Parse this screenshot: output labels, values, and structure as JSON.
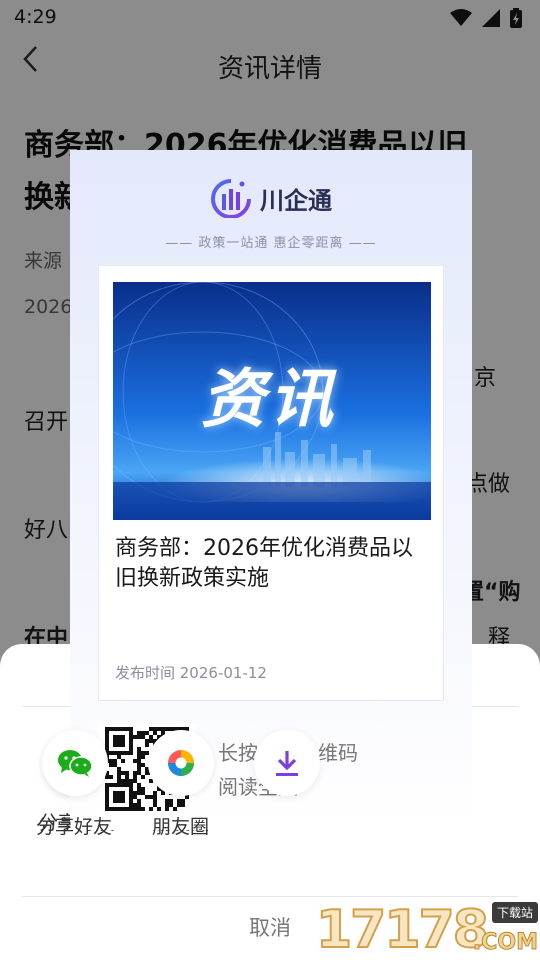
{
  "status_bar": {
    "time": "4:29"
  },
  "nav": {
    "title": "资讯详情"
  },
  "article": {
    "title_line1": "商务部：2026年优化消费品以旧",
    "title_line2": "换新",
    "source_prefix": "来源",
    "date_prefix": "2026",
    "fragments": {
      "a": "京",
      "b": "召开",
      "c": "点做",
      "d": "好八",
      "e": "置“购",
      "f": "在中",
      "g": "释"
    }
  },
  "poster": {
    "brand": "川企通",
    "slogan": "—— 政策一站通  惠企零距离 ——",
    "image_text": "资讯",
    "headline": "商务部：2026年优化消费品以旧换新政策实施",
    "date": "发布时间 2026-01-12",
    "qr_hint_line1": "长按识别二维码",
    "qr_hint_line2": "阅读全文"
  },
  "share_sheet": {
    "items": [
      {
        "label": "分享好友",
        "icon": "wechat-icon"
      },
      {
        "label": "朋友圈",
        "icon": "moments-icon"
      },
      {
        "label": "",
        "icon": "download-icon"
      }
    ],
    "cancel": "取消"
  },
  "watermark": {
    "digits": "17178",
    "tag": "下载站",
    "suffix": ".COM"
  },
  "colors": {
    "wechat": "#1aad19",
    "download": "#7b3fe4",
    "brand_purple": "#6b46e5"
  }
}
